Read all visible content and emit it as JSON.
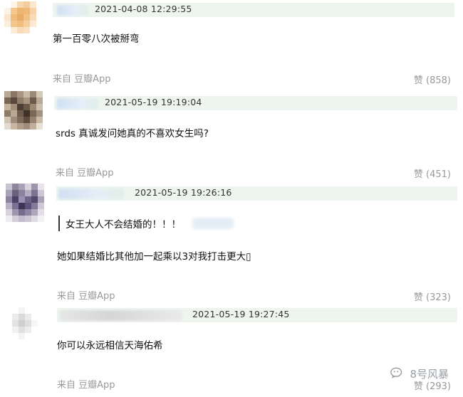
{
  "comments": [
    {
      "time": "2021-04-08 12:29:55",
      "text": "第一百零八次被掰弯",
      "source": "来自 豆瓣App",
      "likes": "赞 (858)"
    },
    {
      "time": "2021-05-19 19:19:04",
      "text": "srds 真诚发问她真的不喜欢女生吗?",
      "source": "来自 豆瓣App",
      "likes": "赞 (451)"
    },
    {
      "time": "2021-05-19 19:26:16",
      "quote": "女王大人不会结婚的！！！",
      "text": "她如果结婚比其他加一起乘以3对我打击更大▯",
      "source": "来自 豆瓣App",
      "likes": "赞 (323)"
    },
    {
      "time": "2021-05-19 19:27:45",
      "text": "你可以永远相信天海佑希",
      "source": "来自 豆瓣App",
      "likes": "赞 (293)"
    }
  ],
  "watermark": {
    "text": "8号风暴",
    "icon": "wechat-icon"
  }
}
